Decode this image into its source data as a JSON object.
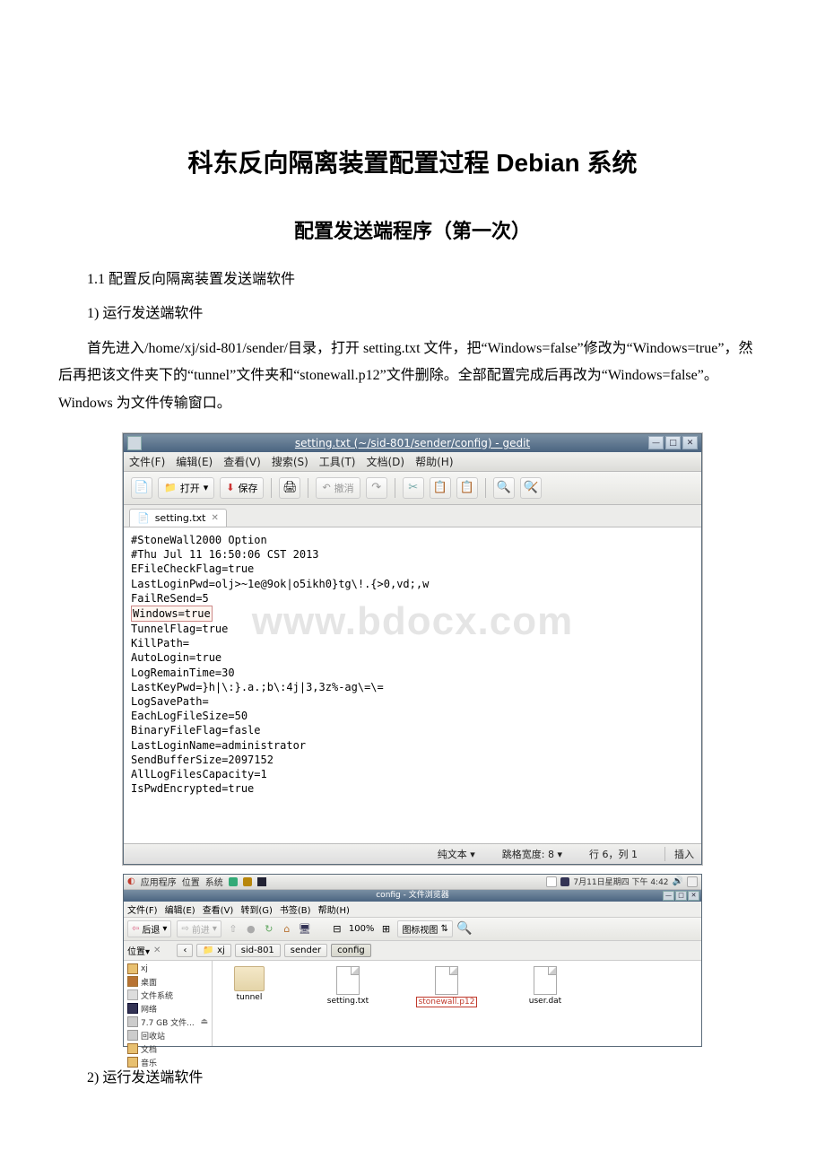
{
  "doc": {
    "title": "科东反向隔离装置配置过程 Debian 系统",
    "subtitle": "配置发送端程序（第一次）",
    "section_1_1": "1.1  配置反向隔离装置发送端软件",
    "step_1": "1) 运行发送端软件",
    "para_1": "首先进入/home/xj/sid-801/sender/目录，打开 setting.txt 文件，把“Windows=false”修改为“Windows=true”，然后再把该文件夹下的“tunnel”文件夹和“stonewall.p12”文件删除。全部配置完成后再改为“Windows=false”。Windows 为文件传输窗口。",
    "step_2": "2) 运行发送端软件"
  },
  "gedit": {
    "title": "setting.txt (~/sid-801/sender/config) - gedit",
    "menus": {
      "file": "文件(F)",
      "edit": "编辑(E)",
      "view": "查看(V)",
      "search": "搜索(S)",
      "tools": "工具(T)",
      "docs": "文档(D)",
      "help": "帮助(H)"
    },
    "toolbar": {
      "open": "打开",
      "save": "保存",
      "undo": "撤消"
    },
    "tab": "setting.txt",
    "content": {
      "l1": "#StoneWall2000 Option",
      "l2": "#Thu Jul 11 16:50:06 CST 2013",
      "l3": "EFileCheckFlag=true",
      "l4": "LastLoginPwd=olj>~1e@9ok|o5ikh0}tg\\!.{>0,vd;,w",
      "l5": "FailReSend=5",
      "l6": "Windows=true",
      "l7": "TunnelFlag=true",
      "l8": "KillPath=",
      "l9": "AutoLogin=true",
      "l10": "LogRemainTime=30",
      "l11": "LastKeyPwd=}h|\\:}.a.;b\\:4j|3,3z%-ag\\=\\=",
      "l12": "LogSavePath=",
      "l13": "EachLogFileSize=50",
      "l14": "BinaryFileFlag=fasle",
      "l15": "LastLoginName=administrator",
      "l16": "SendBufferSize=2097152",
      "l17": "AllLogFilesCapacity=1",
      "l18": "IsPwdEncrypted=true"
    },
    "watermark": "www.bdocx.com",
    "status": {
      "syntax": "纯文本 ▾",
      "tab_width": "跳格宽度:  8 ▾",
      "pos": "行 6，列 1",
      "ins": "插入"
    }
  },
  "fb": {
    "panel": {
      "apps": "应用程序",
      "places": "位置",
      "system": "系统",
      "clock": "7月11日星期四 下午  4:42"
    },
    "title": "config - 文件浏览器",
    "menus": {
      "file": "文件(F)",
      "edit": "编辑(E)",
      "view": "查看(V)",
      "go": "转到(G)",
      "bookmarks": "书签(B)",
      "help": "帮助(H)"
    },
    "toolbar": {
      "back": "后退",
      "forward": "前进",
      "zoom": "100%",
      "view_mode": "图标视图"
    },
    "location_label": "位置▾",
    "crumbs": {
      "c1": "xj",
      "c2": "sid-801",
      "c3": "sender",
      "c4": "config"
    },
    "side": {
      "s1": "xj",
      "s2": "桌面",
      "s3": "文件系统",
      "s4": "网络",
      "s5": "7.7 GB 文件...",
      "s6": "回收站",
      "s7": "文档",
      "s8": "音乐"
    },
    "items": {
      "i1": "tunnel",
      "i2": "setting.txt",
      "i3": "stonewall.p12",
      "i4": "user.dat"
    }
  }
}
